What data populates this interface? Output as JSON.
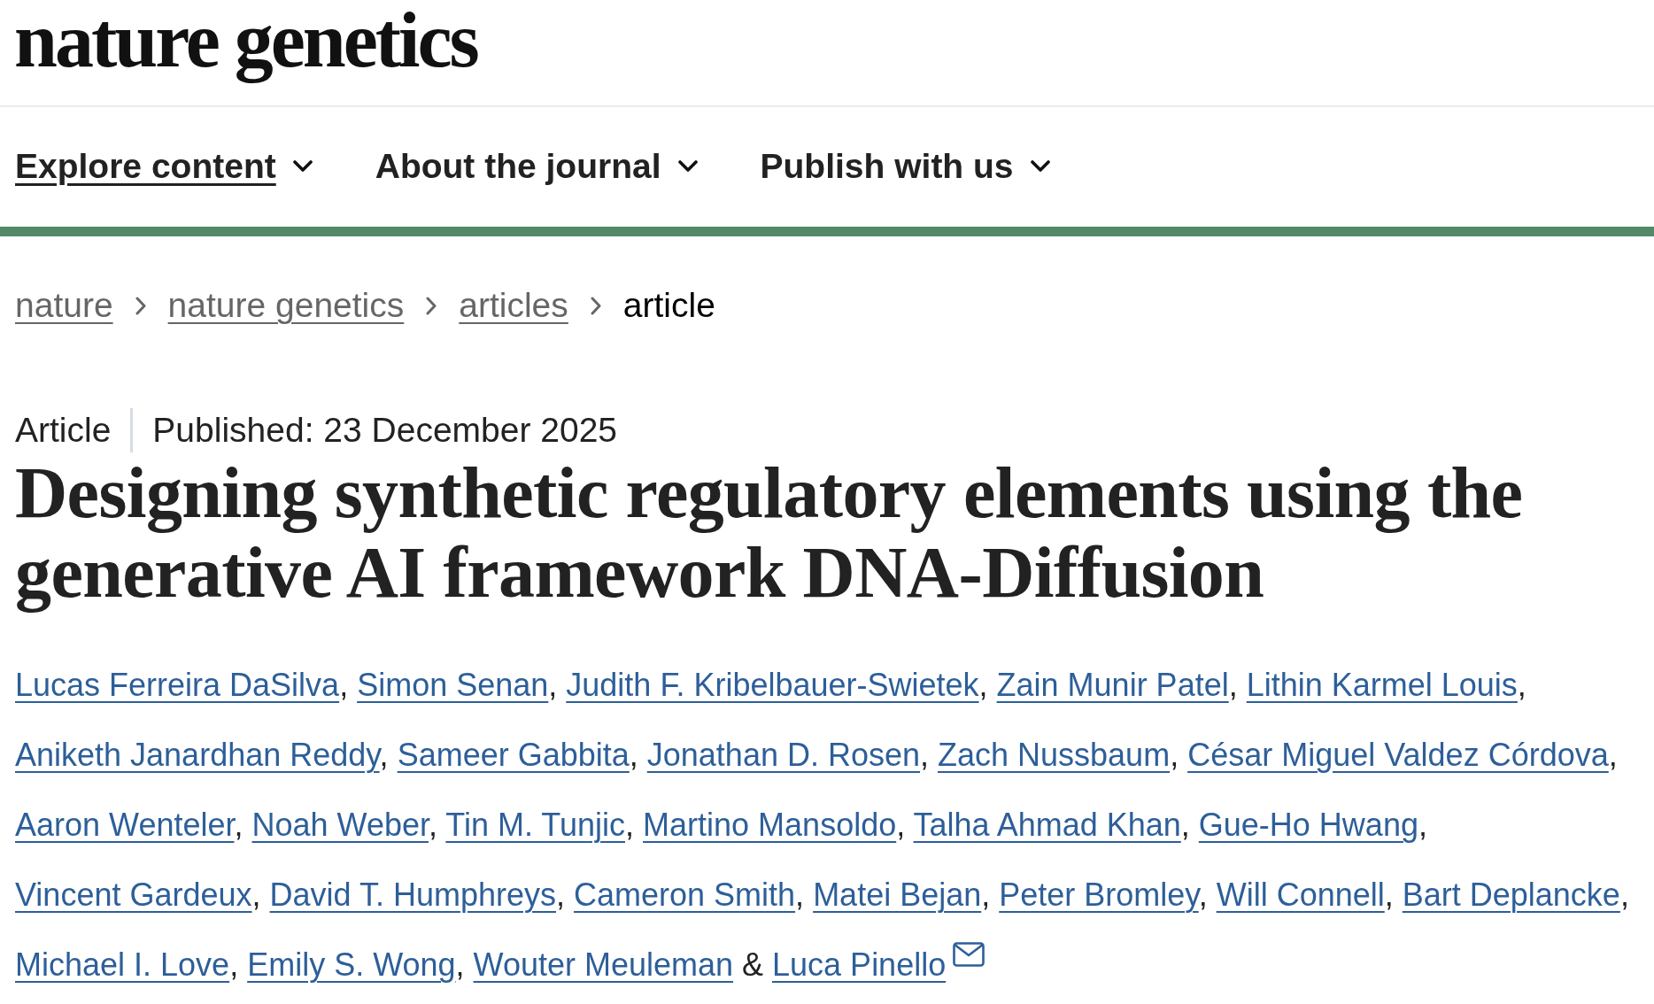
{
  "masthead": {
    "logo": "nature genetics"
  },
  "nav": [
    {
      "label": "Explore content",
      "active": true
    },
    {
      "label": "About the journal",
      "active": false
    },
    {
      "label": "Publish with us",
      "active": false
    }
  ],
  "breadcrumbs": [
    {
      "label": "nature",
      "current": false
    },
    {
      "label": "nature genetics",
      "current": false
    },
    {
      "label": "articles",
      "current": false
    },
    {
      "label": "article",
      "current": true
    }
  ],
  "article": {
    "type": "Article",
    "published": "Published: 23 December 2025",
    "title": "Designing synthetic regulatory elements using the generative AI framework DNA-Diffusion",
    "authors": [
      {
        "name": "Lucas Ferreira DaSilva",
        "separator": ", ",
        "corresponding": false
      },
      {
        "name": "Simon Senan",
        "separator": ", ",
        "corresponding": false
      },
      {
        "name": "Judith F. Kribelbauer-Swietek",
        "separator": ", ",
        "corresponding": false
      },
      {
        "name": "Zain Munir Patel",
        "separator": ", ",
        "corresponding": false
      },
      {
        "name": "Lithin Karmel Louis",
        "separator": ", ",
        "corresponding": false
      },
      {
        "name": "Aniketh Janardhan Reddy",
        "separator": ", ",
        "corresponding": false
      },
      {
        "name": "Sameer Gabbita",
        "separator": ", ",
        "corresponding": false
      },
      {
        "name": "Jonathan D. Rosen",
        "separator": ", ",
        "corresponding": false
      },
      {
        "name": "Zach Nussbaum",
        "separator": ", ",
        "corresponding": false
      },
      {
        "name": "César Miguel Valdez Córdova",
        "separator": ", ",
        "corresponding": false
      },
      {
        "name": "Aaron Wenteler",
        "separator": ", ",
        "corresponding": false
      },
      {
        "name": "Noah Weber",
        "separator": ", ",
        "corresponding": false
      },
      {
        "name": "Tin M. Tunjic",
        "separator": ", ",
        "corresponding": false
      },
      {
        "name": "Martino Mansoldo",
        "separator": ", ",
        "corresponding": false
      },
      {
        "name": "Talha Ahmad Khan",
        "separator": ", ",
        "corresponding": false
      },
      {
        "name": "Gue-Ho Hwang",
        "separator": ", ",
        "corresponding": false
      },
      {
        "name": "Vincent Gardeux",
        "separator": ", ",
        "corresponding": false
      },
      {
        "name": "David T. Humphreys",
        "separator": ", ",
        "corresponding": false
      },
      {
        "name": "Cameron Smith",
        "separator": ", ",
        "corresponding": false
      },
      {
        "name": "Matei Bejan",
        "separator": ", ",
        "corresponding": false
      },
      {
        "name": "Peter Bromley",
        "separator": ", ",
        "corresponding": false
      },
      {
        "name": "Will Connell",
        "separator": ", ",
        "corresponding": false
      },
      {
        "name": "Bart Deplancke",
        "separator": ", ",
        "corresponding": false
      },
      {
        "name": "Michael I. Love",
        "separator": ", ",
        "corresponding": false
      },
      {
        "name": "Emily S. Wong",
        "separator": ", ",
        "corresponding": false
      },
      {
        "name": "Wouter Meuleman",
        "separator": " & ",
        "corresponding": false
      },
      {
        "name": "Luca Pinello",
        "corresponding": true
      }
    ]
  }
}
